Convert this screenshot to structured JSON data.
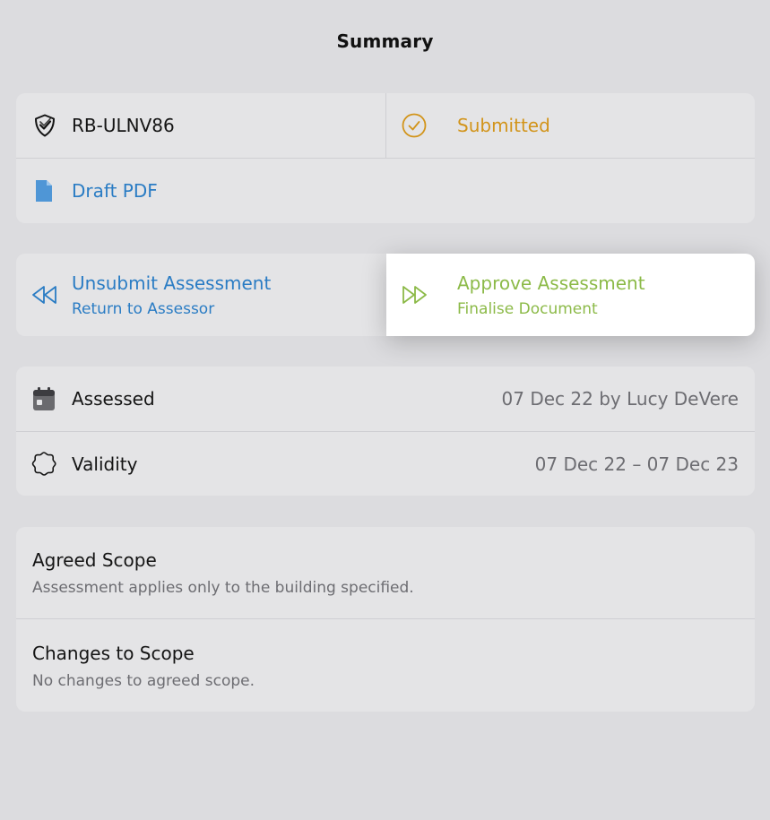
{
  "header": {
    "title": "Summary"
  },
  "status_card": {
    "reference": "RB-ULNV86",
    "status": "Submitted",
    "draft_pdf_label": "Draft PDF"
  },
  "actions": {
    "unsubmit": {
      "title": "Unsubmit Assessment",
      "subtitle": "Return to Assessor"
    },
    "approve": {
      "title": "Approve Assessment",
      "subtitle": "Finalise Document"
    }
  },
  "dates": {
    "assessed_label": "Assessed",
    "assessed_value": "07 Dec 22 by Lucy DeVere",
    "validity_label": "Validity",
    "validity_value": "07 Dec 22 – 07 Dec 23"
  },
  "scope": {
    "agreed": {
      "title": "Agreed Scope",
      "text": "Assessment applies only to the building specified."
    },
    "changes": {
      "title": "Changes to Scope",
      "text": "No changes to agreed scope."
    }
  },
  "icons": {
    "reference": "shield-check-icon",
    "status": "check-circle-icon",
    "pdf": "document-icon",
    "unsubmit": "rewind-icon",
    "approve": "fast-forward-icon",
    "assessed": "calendar-icon",
    "validity": "seal-icon"
  },
  "colors": {
    "link_blue": "#2a7cc4",
    "submitted_gold": "#d2941a",
    "approve_green": "#8cba48",
    "background": "#dcdcdf",
    "card": "#e4e4e6"
  }
}
